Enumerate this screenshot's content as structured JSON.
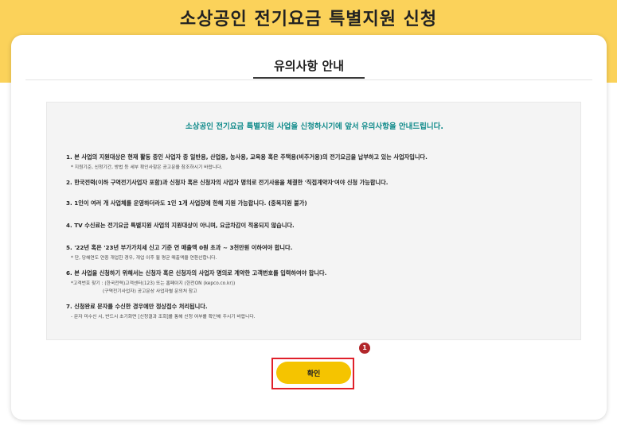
{
  "page": {
    "title": "소상공인 전기요금 특별지원 신청"
  },
  "notice": {
    "title": "유의사항 안내",
    "intro": "소상공인 전기요금 특별지원 사업을 신청하시기에 앞서 유의사항을 안내드립니다.",
    "items": [
      {
        "main": "1. 본 사업의 지원대상은 현재 활동 중인 사업자 중 일반용, 산업용, 농사용, 교육용 혹은 주택용(비주거용)의 전기요금을 납부하고 있는 사업자입니다.",
        "sub": "* 지원기준, 신청기간, 방법 등 세부 확인사항은 공고문을 참조하시기 바랍니다."
      },
      {
        "main": "2. 한국전력(이하 구역전기사업자 포함)과 신청자 혹은 신청자의 사업자 명의로 전기사용을 체결한 '직접계약자'여야 신청 가능합니다."
      },
      {
        "main": "3. 1인이 여러 개 사업체를 운영하더라도 1인 1개 사업장에 한해 지원 가능합니다. (중복지원 불가)"
      },
      {
        "main": "4. TV 수신료는 전기요금 특별지원 사업의 지원대상이 아니며, 요금차감이 적용되지 않습니다."
      },
      {
        "main": "5. '22년 혹은 '23년 부가가치세 신고 기준 연 매출액 0원 초과 ~ 3천만원 이하여야 합니다.",
        "sub": "* 단, 당해연도 연중 개업한 경우, 개업 이후 월 평균 매출액을 연환산합니다."
      },
      {
        "main": "6. 본 사업을 신청하기 위해서는 신청자 혹은 신청자의 사업자 명의로 계약한 고객번호를 입력하여야 합니다.",
        "sub": "*고객번호 찾기 : (한국전력)고객센터(123) 또는 홈페이지 (한전ON (kepco.co.kr))",
        "sub2": "(구역전기사업자) 공고문상 사업자별 문의처 참고"
      },
      {
        "main": "7. 신청완료 문자를 수신한 경우에만 정상접수 처리됩니다.",
        "sub": "- 문자 미수신 시, 반드시 초기화면 [신청결과 조회]를 통해 신청 여부를 확인해 주시기 바랍니다."
      }
    ]
  },
  "actions": {
    "confirm_label": "확인",
    "step_badge": "1"
  },
  "colors": {
    "header_band": "#fbd25a",
    "button": "#f5c400",
    "intro_text": "#0f8a8a",
    "highlight_border": "#e0202a",
    "badge": "#b2262a"
  }
}
